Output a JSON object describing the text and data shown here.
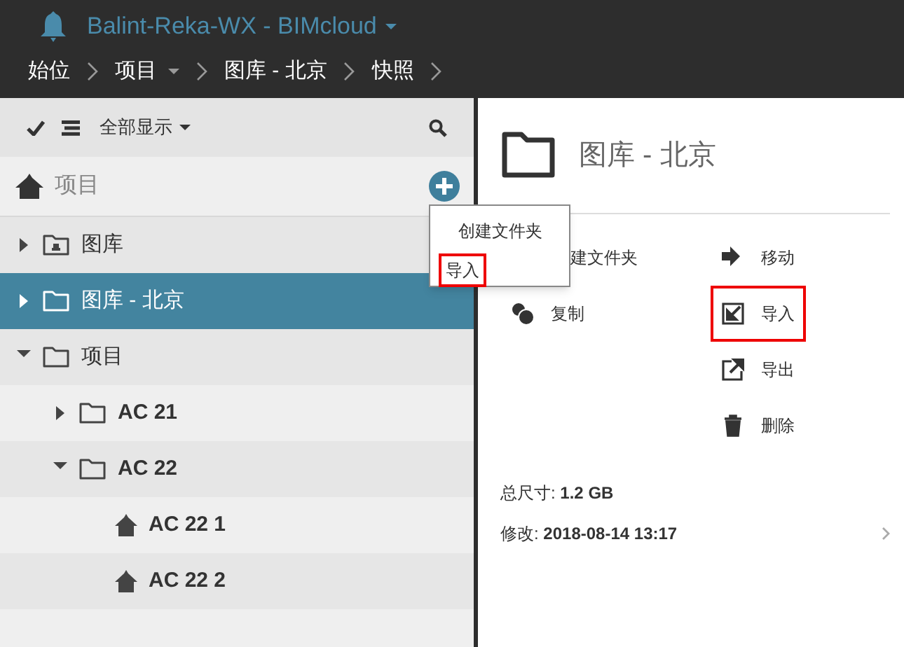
{
  "header": {
    "title": "Balint-Reka-WX - BIMcloud",
    "breadcrumbs": [
      {
        "label": "始位",
        "dropdown": false
      },
      {
        "label": "项目",
        "dropdown": true
      },
      {
        "label": "图库 - 北京",
        "dropdown": false
      },
      {
        "label": "快照",
        "dropdown": false
      }
    ]
  },
  "toolbar": {
    "filter": "全部显示"
  },
  "root": {
    "label": "项目"
  },
  "tree": [
    {
      "label": "图库",
      "kind": "library",
      "expanded": false,
      "selected": false
    },
    {
      "label": "图库 - 北京",
      "kind": "folder",
      "expanded": false,
      "selected": true
    },
    {
      "label": "项目",
      "kind": "folder",
      "expanded": true,
      "selected": false,
      "children": [
        {
          "label": "AC 21",
          "kind": "folder",
          "expanded": false,
          "selected": false
        },
        {
          "label": "AC 22",
          "kind": "folder",
          "expanded": true,
          "selected": false,
          "children": [
            {
              "label": "AC 22 1",
              "kind": "project",
              "selected": false
            },
            {
              "label": "AC 22 2",
              "kind": "project",
              "selected": false
            }
          ]
        }
      ]
    }
  ],
  "popup_menu": [
    {
      "label": "创建文件夹",
      "highlighted": false
    },
    {
      "label": "导入",
      "highlighted": true
    }
  ],
  "details": {
    "title": "图库 - 北京",
    "actions_left": [
      {
        "label": "建文件夹",
        "kind": "covered",
        "highlighted": false
      },
      {
        "label": "复制",
        "kind": "copy",
        "highlighted": false
      }
    ],
    "actions_right": [
      {
        "label": "移动",
        "kind": "move",
        "highlighted": false
      },
      {
        "label": "导入",
        "kind": "import",
        "highlighted": true
      },
      {
        "label": "导出",
        "kind": "export",
        "highlighted": false
      },
      {
        "label": "删除",
        "kind": "delete",
        "highlighted": false
      }
    ],
    "info": [
      "总尺寸: **1.2 GB**",
      "修改: **2018-08-14 13:17**"
    ]
  }
}
